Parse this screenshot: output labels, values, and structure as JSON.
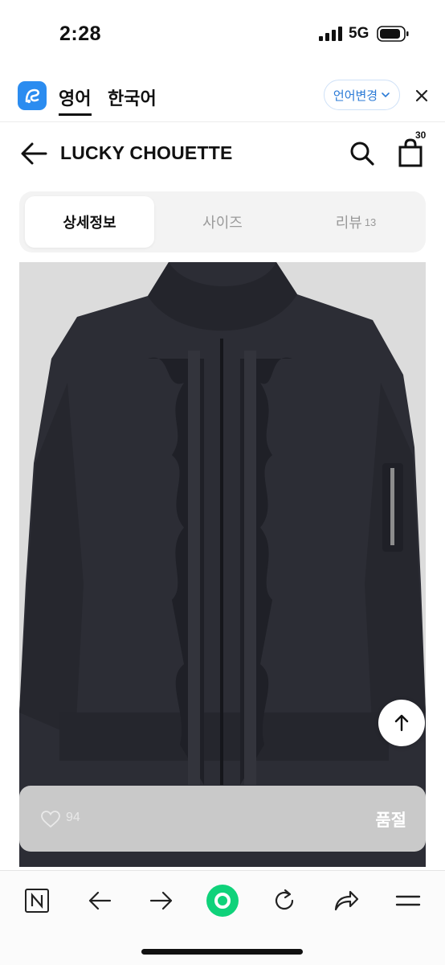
{
  "status_bar": {
    "time": "2:28",
    "network": "5G"
  },
  "translate_bar": {
    "source_language": "영어",
    "target_language": "한국어",
    "change_language_label": "언어변경",
    "accent_color": "#2b8cf0"
  },
  "header": {
    "brand": "LUCKY CHOUETTE",
    "cart_count": "30"
  },
  "tabs": [
    {
      "label": "상세정보",
      "active": true
    },
    {
      "label": "사이즈",
      "active": false
    },
    {
      "label": "리뷰",
      "count": "13",
      "active": false
    }
  ],
  "product_image": {
    "icon": "black-ruffle-bomber-jacket-photo"
  },
  "purchase_bar": {
    "likes": "94",
    "status": "품절"
  },
  "toolbar": {
    "icons": [
      "naver-home-icon",
      "back-arrow-icon",
      "forward-arrow-icon",
      "green-circle-icon",
      "refresh-icon",
      "share-icon",
      "menu-icon"
    ],
    "green": "#0fd27a"
  }
}
